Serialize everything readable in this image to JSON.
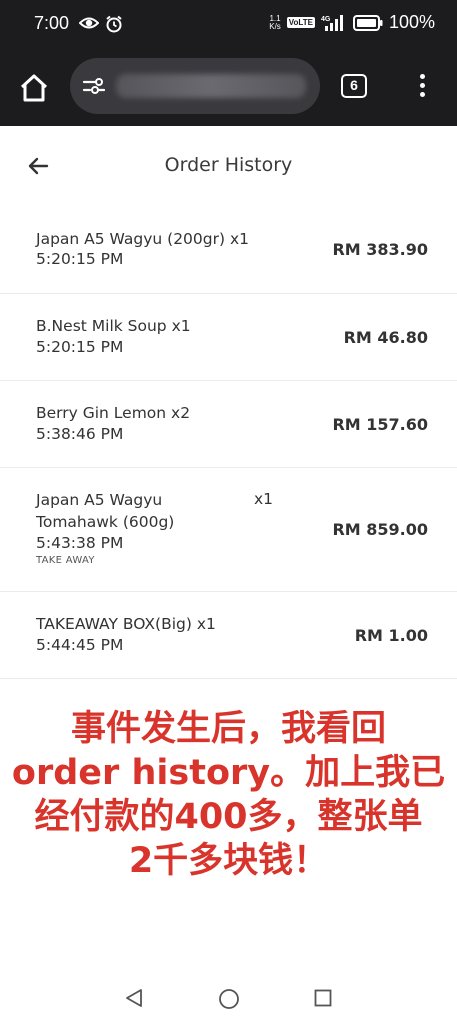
{
  "status_bar": {
    "time": "7:00",
    "speed_top": "1.1",
    "speed_bottom": "K/s",
    "volte": "VoLTE",
    "network": "4G",
    "battery": "100%"
  },
  "browser": {
    "tabs_count": "6",
    "url": "blurred"
  },
  "header": {
    "title": "Order History"
  },
  "orders": [
    {
      "name": "Japan A5 Wagyu (200gr) x1",
      "time": "5:20:15 PM",
      "price": "RM 383.90"
    },
    {
      "name": "B.Nest Milk Soup x1",
      "time": "5:20:15 PM",
      "price": "RM 46.80"
    },
    {
      "name": "Berry Gin Lemon x2",
      "time": "5:38:46 PM",
      "price": "RM 157.60"
    },
    {
      "name_line1": "Japan A5 Wagyu",
      "name_line2": "Tomahawk (600g)",
      "qty": "x1",
      "time": "5:43:38 PM",
      "note": "TAKE AWAY",
      "price": "RM 859.00"
    },
    {
      "name": "TAKEAWAY BOX(Big) x1",
      "time": "5:44:45 PM",
      "price": "RM 1.00"
    }
  ],
  "overlay": {
    "line1": "事件发生后，我看回",
    "line2": "order history。加上我已",
    "line3": "经付款的400多，整张单",
    "line4": "2千多块钱！"
  },
  "colors": {
    "bar_bg": "#1c1c1e",
    "overlay_text": "#d9342b"
  }
}
